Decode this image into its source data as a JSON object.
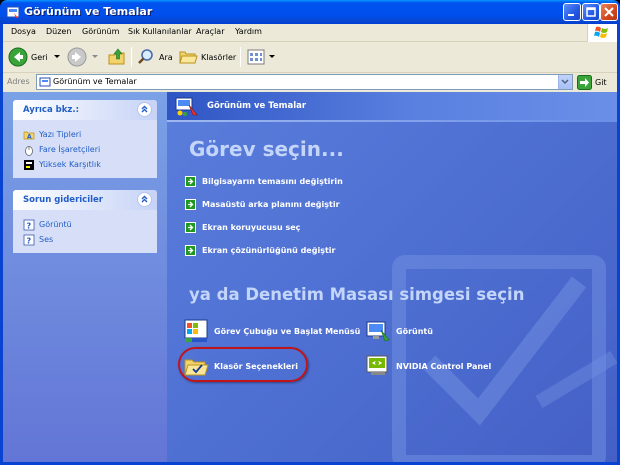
{
  "window": {
    "title": "Görünüm ve Temalar"
  },
  "menu": [
    "Dosya",
    "Düzen",
    "Görünüm",
    "Sık Kullanılanlar",
    "Araçlar",
    "Yardım"
  ],
  "toolbar": {
    "back_label": "Geri",
    "search_label": "Ara",
    "folders_label": "Klasörler"
  },
  "address": {
    "label": "Adres",
    "value": "Görünüm ve Temalar",
    "go_label": "Git"
  },
  "see_also": {
    "title": "Ayrıca bkz.:",
    "items": [
      "Yazı Tipleri",
      "Fare İşaretçileri",
      "Yüksek Karşıtlık"
    ]
  },
  "troubleshooters": {
    "title": "Sorun gidericiler",
    "items": [
      "Görüntü",
      "Ses"
    ]
  },
  "main": {
    "header": "Görünüm ve Temalar",
    "task_title": "Görev seçin...",
    "tasks": [
      "Bilgisayarın temasını değiştirin",
      "Masaüstü arka planını değiştir",
      "Ekran koruyucusu seç",
      "Ekran çözünürlüğünü değiştir"
    ],
    "or_title": "ya da Denetim Masası simgesi seçin",
    "icons": [
      "Görev Çubuğu ve Başlat Menüsü",
      "Görüntü",
      "Klasör Seçenekleri",
      "NVIDIA Control Panel"
    ]
  },
  "colors": {
    "title_bar": "#0053ee",
    "left_pane": "#7aa1e6",
    "main_pane": "#5a7edc",
    "link": "#215dc6",
    "highlight_circle": "#c0141b"
  }
}
